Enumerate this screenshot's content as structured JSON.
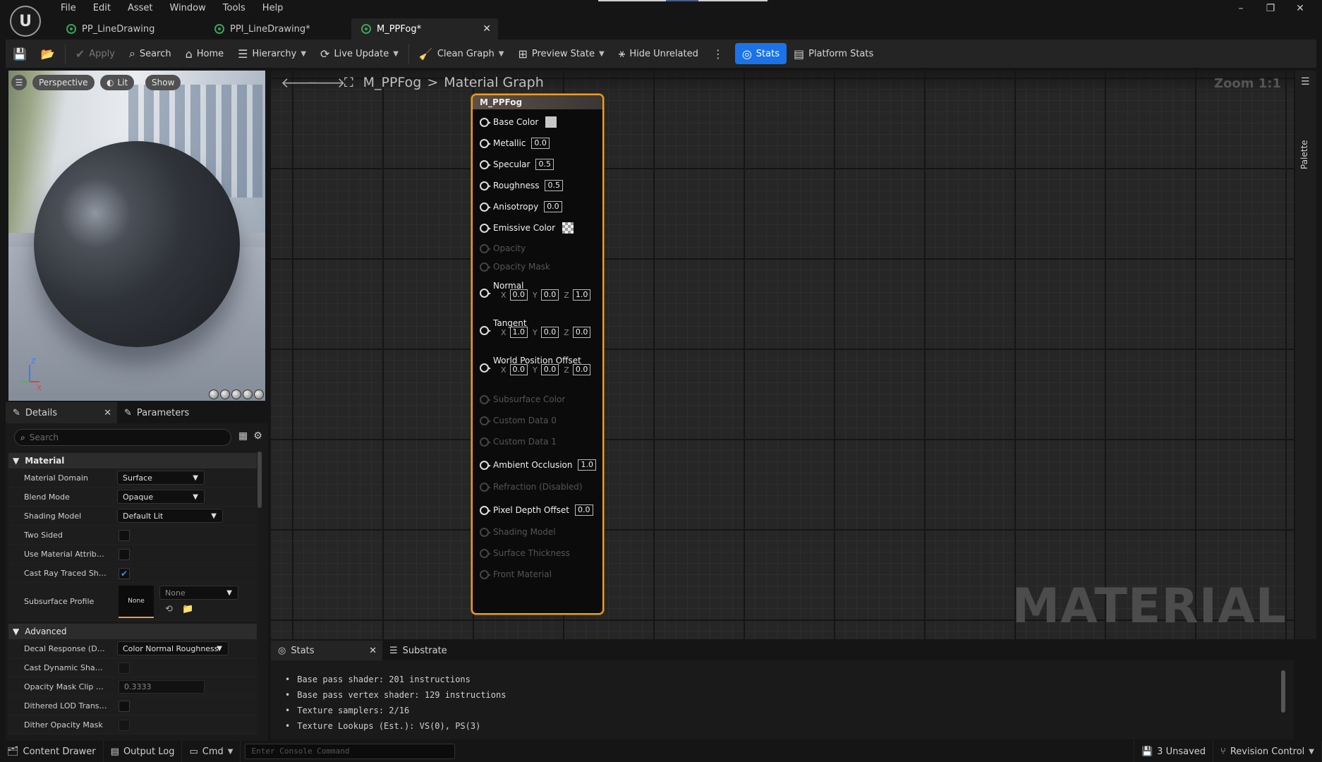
{
  "menu": [
    "File",
    "Edit",
    "Asset",
    "Window",
    "Tools",
    "Help"
  ],
  "window_controls": [
    "–",
    "❐",
    "✕"
  ],
  "tabs": [
    {
      "label": "PP_LineDrawing",
      "active": false
    },
    {
      "label": "PPI_LineDrawing*",
      "active": false
    },
    {
      "label": "M_PPFog*",
      "active": true
    }
  ],
  "toolbar": {
    "apply": "Apply",
    "search": "Search",
    "home": "Home",
    "hierarchy": "Hierarchy",
    "live_update": "Live Update",
    "clean_graph": "Clean Graph",
    "preview_state": "Preview State",
    "hide_unrelated": "Hide Unrelated",
    "stats": "Stats",
    "platform_stats": "Platform Stats"
  },
  "viewport": {
    "perspective": "Perspective",
    "lit": "Lit",
    "show": "Show",
    "axis_z": "Z",
    "axis_x": "X"
  },
  "details": {
    "tab_details": "Details",
    "tab_parameters": "Parameters",
    "search_placeholder": "Search",
    "cat_material": "Material",
    "cat_advanced": "Advanced",
    "material_domain_label": "Material Domain",
    "material_domain_value": "Surface",
    "blend_mode_label": "Blend Mode",
    "blend_mode_value": "Opaque",
    "shading_model_label": "Shading Model",
    "shading_model_value": "Default Lit",
    "two_sided_label": "Two Sided",
    "use_attr_label": "Use Material Attributes",
    "cast_ray_label": "Cast Ray Traced Sha...",
    "subsurface_label": "Subsurface Profile",
    "subsurface_thumb": "None",
    "subsurface_value": "None",
    "decal_label": "Decal Response (DBu...",
    "decal_value": "Color Normal Roughness",
    "cast_dyn_label": "Cast Dynamic Shado...",
    "opacity_clip_label": "Opacity Mask Clip V...",
    "opacity_clip_value": "0.3333",
    "dithered_label": "Dithered LOD Transiti...",
    "dither_opacity_label": "Dither Opacity Mask"
  },
  "graph": {
    "breadcrumb_root": "M_PPFog",
    "breadcrumb_sep": ">",
    "breadcrumb_leaf": "Material Graph",
    "zoom": "Zoom 1:1",
    "watermark": "MATERIAL"
  },
  "node": {
    "title": "M_PPFog",
    "pins": {
      "base_color": "Base Color",
      "metallic": "Metallic",
      "metallic_val": "0.0",
      "specular": "Specular",
      "specular_val": "0.5",
      "roughness": "Roughness",
      "roughness_val": "0.5",
      "anisotropy": "Anisotropy",
      "anisotropy_val": "0.0",
      "emissive": "Emissive Color",
      "opacity": "Opacity",
      "opacity_mask": "Opacity Mask",
      "normal": "Normal",
      "normal_x": "0.0",
      "normal_y": "0.0",
      "normal_z": "1.0",
      "tangent": "Tangent",
      "tangent_x": "1.0",
      "tangent_y": "0.0",
      "tangent_z": "0.0",
      "wpo": "World Position Offset",
      "wpo_x": "0.0",
      "wpo_y": "0.0",
      "wpo_z": "0.0",
      "subsurface_color": "Subsurface Color",
      "custom0": "Custom Data 0",
      "custom1": "Custom Data 1",
      "ao": "Ambient Occlusion",
      "ao_val": "1.0",
      "refraction": "Refraction (Disabled)",
      "pdo": "Pixel Depth Offset",
      "pdo_val": "0.0",
      "shading_model": "Shading Model",
      "surface_thickness": "Surface Thickness",
      "front_material": "Front Material",
      "x": "X",
      "y": "Y",
      "z": "Z"
    }
  },
  "palette": {
    "label": "Palette"
  },
  "stats": {
    "tab_stats": "Stats",
    "tab_substrate": "Substrate",
    "lines": [
      "Base pass shader: 201 instructions",
      "Base pass vertex shader: 129 instructions",
      "Texture samplers: 2/16",
      "Texture Lookups (Est.): VS(0), PS(3)"
    ]
  },
  "statusbar": {
    "content_drawer": "Content Drawer",
    "output_log": "Output Log",
    "cmd": "Cmd",
    "console_placeholder": "Enter Console Command",
    "unsaved": "3 Unsaved",
    "revision_control": "Revision Control"
  },
  "colors": {
    "accent": "#1a73e8",
    "node_border": "#f0a020",
    "tab_icon": "#3aa35a"
  }
}
